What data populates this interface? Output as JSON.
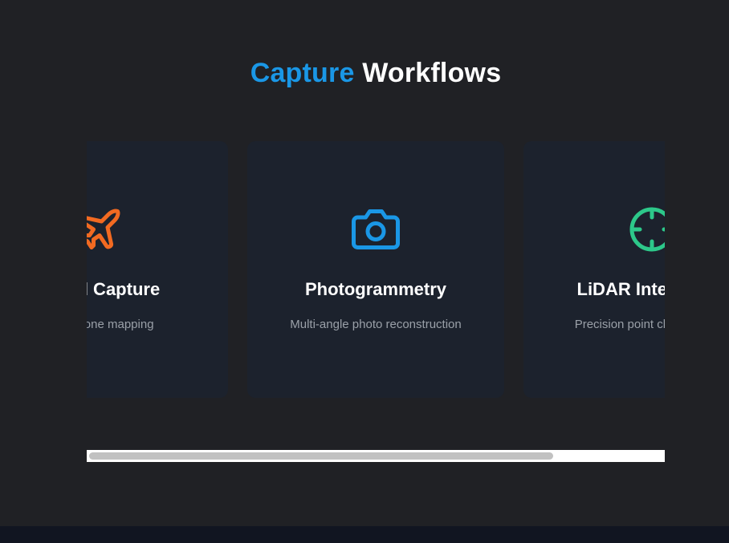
{
  "section": {
    "title_accent": "Capture",
    "title_rest": "Workflows"
  },
  "cards": [
    {
      "title": "Aerial Capture",
      "description": "Auto drone mapping",
      "icon": "airplane-icon",
      "color": "#f26a21"
    },
    {
      "title": "Photogrammetry",
      "description": "Multi-angle photo reconstruction",
      "icon": "camera-icon",
      "color": "#1a97e6"
    },
    {
      "title": "LiDAR Integration",
      "description": "Precision point cloud capture",
      "icon": "crosshair-icon",
      "color": "#2dc88a"
    }
  ],
  "scroll": {
    "position_fraction": 0.2,
    "visible_fraction": 0.81
  },
  "colors": {
    "background": "#202125",
    "card": "#1c222d",
    "accent": "#1a97e6",
    "footer": "#111521"
  }
}
